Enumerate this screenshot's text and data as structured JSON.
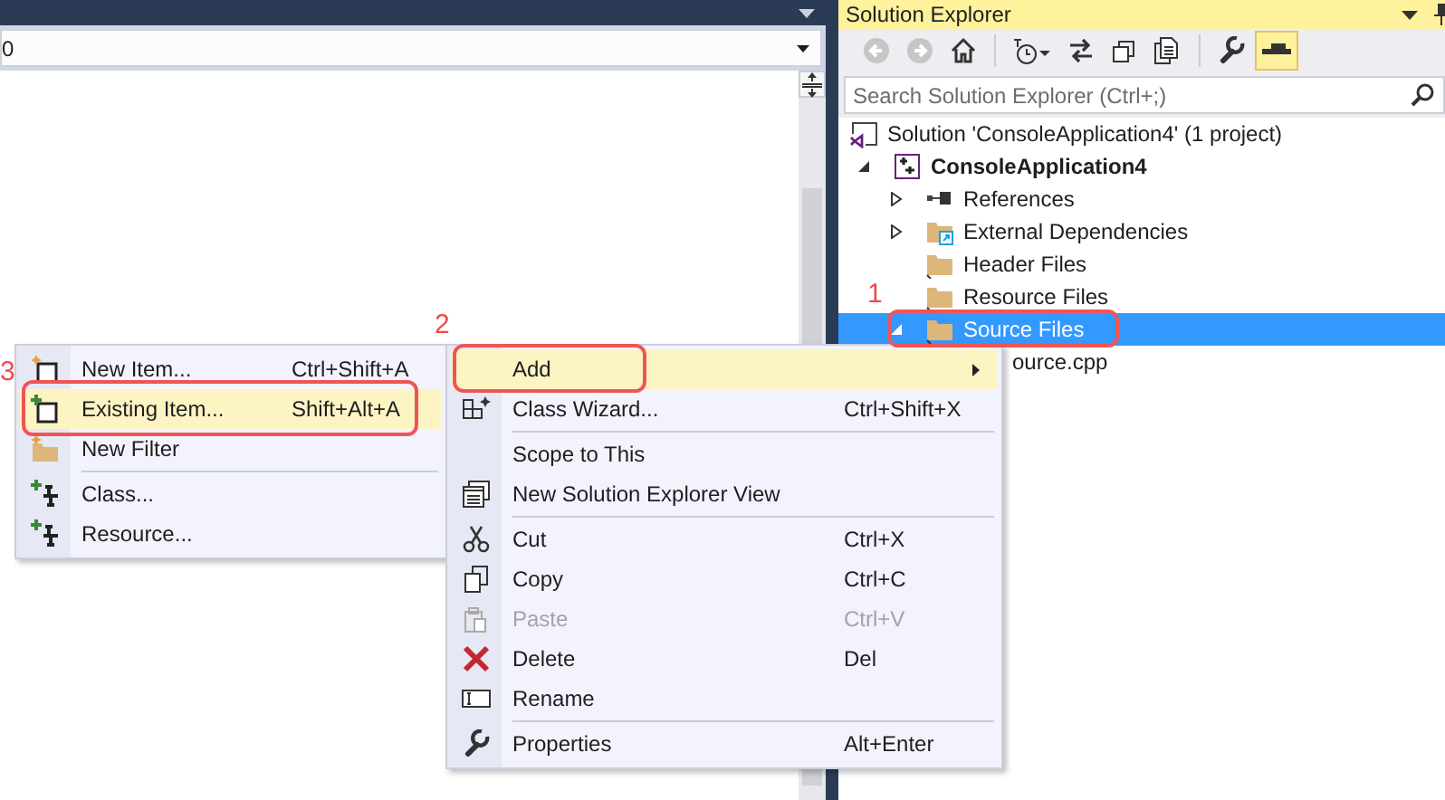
{
  "editor": {
    "dropdown_value": "0"
  },
  "solution_explorer": {
    "title": "Solution Explorer",
    "toolbar": [
      {
        "kind": "button",
        "disabled": true,
        "on": false
      },
      {
        "kind": "button",
        "disabled": true,
        "on": false
      },
      {
        "kind": "button",
        "disabled": false,
        "on": false
      },
      {
        "kind": "separator"
      },
      {
        "kind": "button",
        "disabled": false,
        "on": false
      },
      {
        "kind": "button",
        "disabled": false,
        "on": false
      },
      {
        "kind": "button",
        "disabled": false,
        "on": false
      },
      {
        "kind": "button",
        "disabled": false,
        "on": false
      },
      {
        "kind": "separator"
      },
      {
        "kind": "button",
        "disabled": false,
        "on": false
      },
      {
        "kind": "button",
        "disabled": false,
        "on": true
      }
    ],
    "search": {
      "placeholder": "Search Solution Explorer (Ctrl+;)"
    },
    "tree": [
      {
        "label": "Solution 'ConsoleApplication4' (1 project)",
        "kind": "solution",
        "selected": false,
        "children": [
          {
            "label": "ConsoleApplication4",
            "kind": "project",
            "selected": false,
            "expanded": true,
            "children": [
              {
                "label": "References",
                "kind": "references",
                "selected": false,
                "expanded": false
              },
              {
                "label": "External Dependencies",
                "kind": "dependencies",
                "selected": false,
                "expanded": false
              },
              {
                "label": "Header Files",
                "kind": "folder",
                "selected": false
              },
              {
                "label": "Resource Files",
                "kind": "folder",
                "selected": false
              },
              {
                "label": "Source Files",
                "kind": "folder",
                "selected": true,
                "expanded": true,
                "children": [
                  {
                    "label": "ource.cpp",
                    "kind": "file",
                    "selected": false
                  }
                ]
              }
            ]
          }
        ]
      }
    ]
  },
  "context_menu": {
    "items": [
      {
        "kind": "item",
        "label": "Add",
        "selected": true,
        "submenu": true,
        "disabled": false
      },
      {
        "kind": "item",
        "label": "Class Wizard...",
        "shortcut": "Ctrl+Shift+X",
        "selected": false,
        "submenu": false,
        "disabled": false
      },
      {
        "kind": "separator"
      },
      {
        "kind": "item",
        "label": "Scope to This",
        "selected": false,
        "submenu": false,
        "disabled": false
      },
      {
        "kind": "item",
        "label": "New Solution Explorer View",
        "selected": false,
        "submenu": false,
        "disabled": false
      },
      {
        "kind": "separator"
      },
      {
        "kind": "item",
        "label": "Cut",
        "shortcut": "Ctrl+X",
        "selected": false,
        "submenu": false,
        "disabled": false
      },
      {
        "kind": "item",
        "label": "Copy",
        "shortcut": "Ctrl+C",
        "selected": false,
        "submenu": false,
        "disabled": false
      },
      {
        "kind": "item",
        "label": "Paste",
        "shortcut": "Ctrl+V",
        "selected": false,
        "submenu": false,
        "disabled": true
      },
      {
        "kind": "item",
        "label": "Delete",
        "shortcut": "Del",
        "selected": false,
        "submenu": false,
        "disabled": false
      },
      {
        "kind": "item",
        "label": "Rename",
        "selected": false,
        "submenu": false,
        "disabled": false
      },
      {
        "kind": "separator"
      },
      {
        "kind": "item",
        "label": "Properties",
        "shortcut": "Alt+Enter",
        "selected": false,
        "submenu": false,
        "disabled": false
      }
    ]
  },
  "submenu": {
    "items": [
      {
        "kind": "item",
        "label": "New Item...",
        "shortcut": "Ctrl+Shift+A",
        "selected": false,
        "disabled": false
      },
      {
        "kind": "item",
        "label": "Existing Item...",
        "shortcut": "Shift+Alt+A",
        "selected": true,
        "disabled": false
      },
      {
        "kind": "item",
        "label": "New Filter",
        "selected": false,
        "disabled": false
      },
      {
        "kind": "separator"
      },
      {
        "kind": "item",
        "label": "Class...",
        "selected": false,
        "disabled": false
      },
      {
        "kind": "item",
        "label": "Resource...",
        "selected": false,
        "disabled": false
      }
    ]
  },
  "annotations": [
    {
      "number": "1"
    },
    {
      "number": "2"
    },
    {
      "number": "3"
    }
  ]
}
